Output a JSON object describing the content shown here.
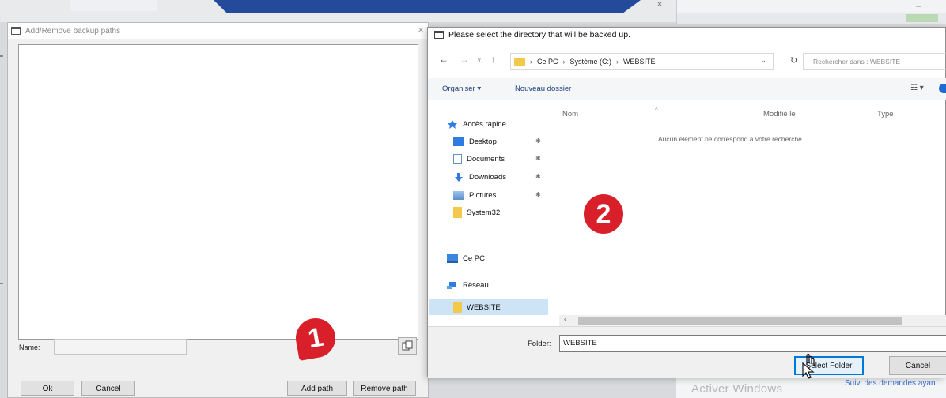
{
  "left_dialog": {
    "title": "Add/Remove backup paths",
    "name_label": "Name:",
    "name_value": "",
    "buttons": {
      "ok": "Ok",
      "cancel": "Cancel",
      "add_path": "Add path",
      "remove_path": "Remove path"
    }
  },
  "right_dialog": {
    "title": "Please select the directory that will be backed up.",
    "address": {
      "segments": [
        "Ce PC",
        "Système (C:)",
        "WEBSITE"
      ]
    },
    "search_placeholder": "Rechercher dans : WEBSITE",
    "toolbar": {
      "organize": "Organiser ▾",
      "new_folder": "Nouveau dossier"
    },
    "nav": {
      "quick_access": "Accès rapide",
      "items": [
        "Desktop",
        "Documents",
        "Downloads",
        "Pictures",
        "System32",
        "WEBSITE"
      ],
      "this_pc": "Ce PC",
      "network": "Réseau"
    },
    "columns": [
      "Nom",
      "Modifié le",
      "Type"
    ],
    "empty_message": "Aucun élément ne correspond à votre recherche.",
    "folder_label": "Folder:",
    "folder_value": "WEBSITE",
    "select_folder": "Select Folder",
    "cancel": "Cancel"
  },
  "annotations": {
    "step1": "1",
    "step2": "2"
  },
  "background": {
    "activate_text": "Activer Windows",
    "side_link": "Suivi des demandes ayan"
  },
  "colors": {
    "badge": "#d9202a",
    "accent": "#0078d7",
    "selection": "#cde3f6",
    "folder": "#f3c94b"
  }
}
